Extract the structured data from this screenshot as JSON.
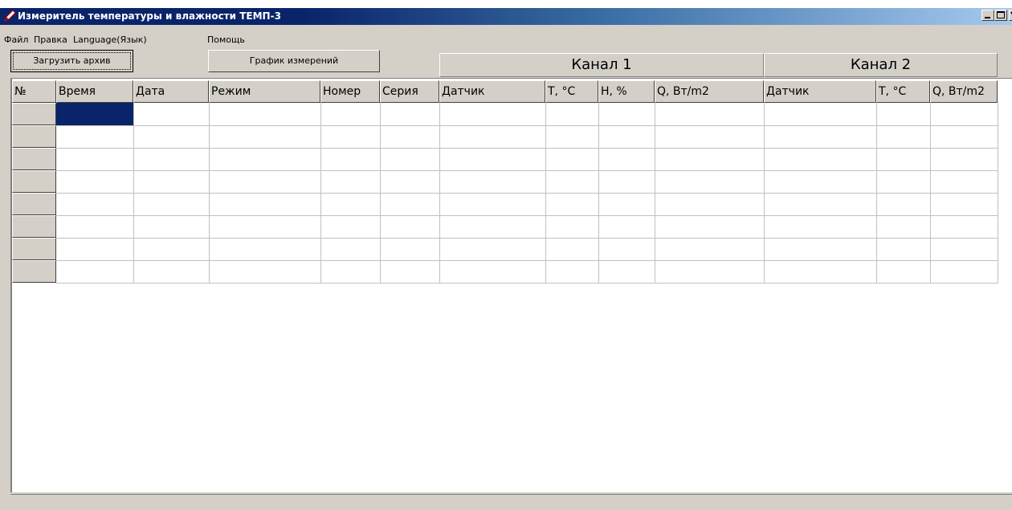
{
  "window": {
    "title": "Измеритель температуры и влажности ТЕМП-3",
    "icon": "pen-icon"
  },
  "menu": [
    "Файл",
    "Правка",
    "Language(Язык)",
    "Помощь"
  ],
  "toolbar": {
    "load_archive_label": "Загрузить архив",
    "chart_label": "График измерений"
  },
  "channels": [
    "Канал 1",
    "Канал 2"
  ],
  "columns": [
    "№",
    "Время",
    "Дата",
    "Режим",
    "Номер",
    "Серия",
    "Датчик",
    "T, °C",
    "H, %",
    "Q, Вт/m2",
    "Датчик",
    "T, °C",
    "Q, Вт/m2"
  ],
  "rows": [
    [
      "",
      "",
      "",
      "",
      "",
      "",
      "",
      "",
      "",
      "",
      "",
      ""
    ],
    [
      "",
      "",
      "",
      "",
      "",
      "",
      "",
      "",
      "",
      "",
      "",
      ""
    ],
    [
      "",
      "",
      "",
      "",
      "",
      "",
      "",
      "",
      "",
      "",
      "",
      ""
    ],
    [
      "",
      "",
      "",
      "",
      "",
      "",
      "",
      "",
      "",
      "",
      "",
      ""
    ],
    [
      "",
      "",
      "",
      "",
      "",
      "",
      "",
      "",
      "",
      "",
      "",
      ""
    ],
    [
      "",
      "",
      "",
      "",
      "",
      "",
      "",
      "",
      "",
      "",
      "",
      ""
    ],
    [
      "",
      "",
      "",
      "",
      "",
      "",
      "",
      "",
      "",
      "",
      "",
      ""
    ],
    [
      "",
      "",
      "",
      "",
      "",
      "",
      "",
      "",
      "",
      "",
      "",
      ""
    ]
  ],
  "colors": {
    "titlebar": "#0a246a",
    "face": "#d4d0c8",
    "selection": "#0a246a"
  }
}
